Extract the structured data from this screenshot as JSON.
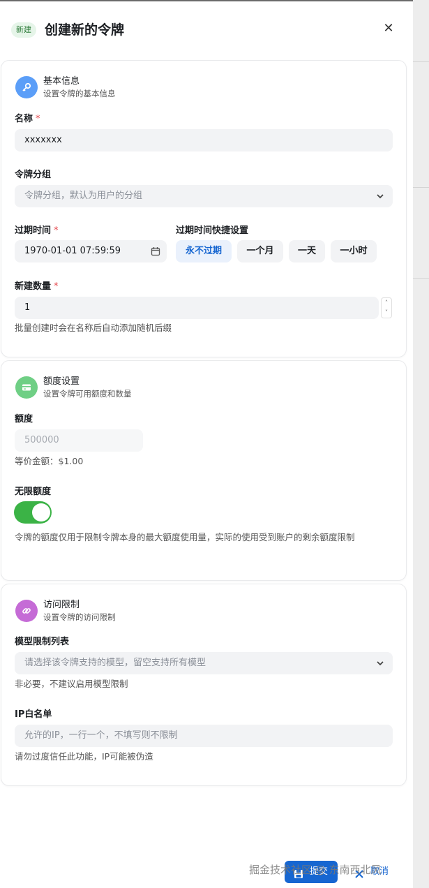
{
  "header": {
    "tag": "新建",
    "title": "创建新的令牌",
    "close_icon": "✕"
  },
  "basic": {
    "title": "基本信息",
    "subtitle": "设置令牌的基本信息",
    "icon": "key-icon",
    "icon_bg": "#5b9ef8",
    "name_label": "名称",
    "name_value": "xxxxxxx",
    "group_label": "令牌分组",
    "group_placeholder": "令牌分组，默认为用户的分组",
    "expire_label": "过期时间",
    "expire_value": "1970-01-01 07:59:59",
    "quick_label": "过期时间快捷设置",
    "quick_options": [
      "永不过期",
      "一个月",
      "一天",
      "一小时"
    ],
    "count_label": "新建数量",
    "count_value": "1",
    "count_help": "批量创建时会在名称后自动添加随机后缀"
  },
  "quota": {
    "title": "额度设置",
    "subtitle": "设置令牌可用额度和数量",
    "icon": "credit-card-icon",
    "icon_bg": "#6fcf85",
    "amount_label": "额度",
    "amount_value": "500000",
    "amount_help": "等价金额：$1.00",
    "unlimited_label": "无限额度",
    "unlimited_on": true,
    "unlimited_help": "令牌的额度仅用于限制令牌本身的最大额度使用量，实际的使用受到账户的剩余额度限制"
  },
  "access": {
    "title": "访问限制",
    "subtitle": "设置令牌的访问限制",
    "icon": "link-icon",
    "icon_bg": "#c56bd6",
    "models_label": "模型限制列表",
    "models_placeholder": "请选择该令牌支持的模型，留空支持所有模型",
    "models_help": "非必要，不建议启用模型限制",
    "ip_label": "IP白名单",
    "ip_placeholder": "允许的IP，一行一个，不填写则不限制",
    "ip_help": "请勿过度信任此功能，IP可能被伪造"
  },
  "footer": {
    "submit": "提交",
    "cancel": "取消"
  },
  "watermark": "掘金技术社区 @ 东南西北风",
  "colors": {
    "primary": "#1666d1",
    "switch_on": "#3bb346",
    "required": "#e5484d"
  }
}
